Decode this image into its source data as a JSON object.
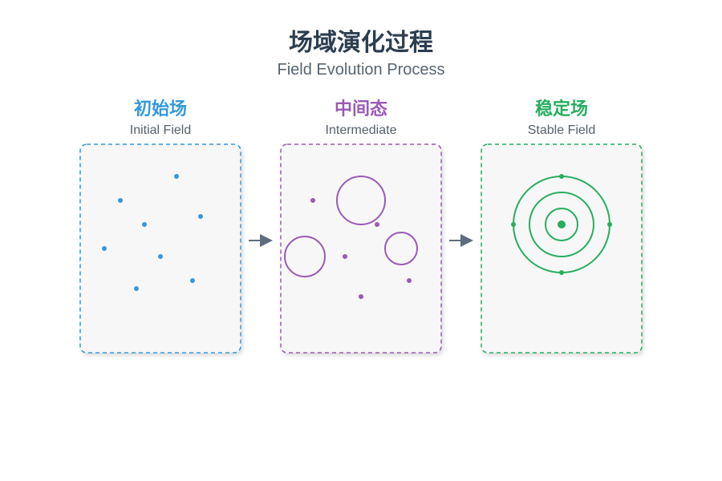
{
  "title": "场域演化过程",
  "subtitle": "Field Evolution Process",
  "colors": {
    "initial": "#3498db",
    "intermediate": "#9b59b6",
    "stable": "#27ae60",
    "arrow": "#5d6d7e",
    "box_fill": "#f7f7f7"
  },
  "stages": [
    {
      "title": "初始场",
      "subtitle": "Initial Field"
    },
    {
      "title": "中间态",
      "subtitle": "Intermediate"
    },
    {
      "title": "稳定场",
      "subtitle": "Stable Field"
    }
  ]
}
